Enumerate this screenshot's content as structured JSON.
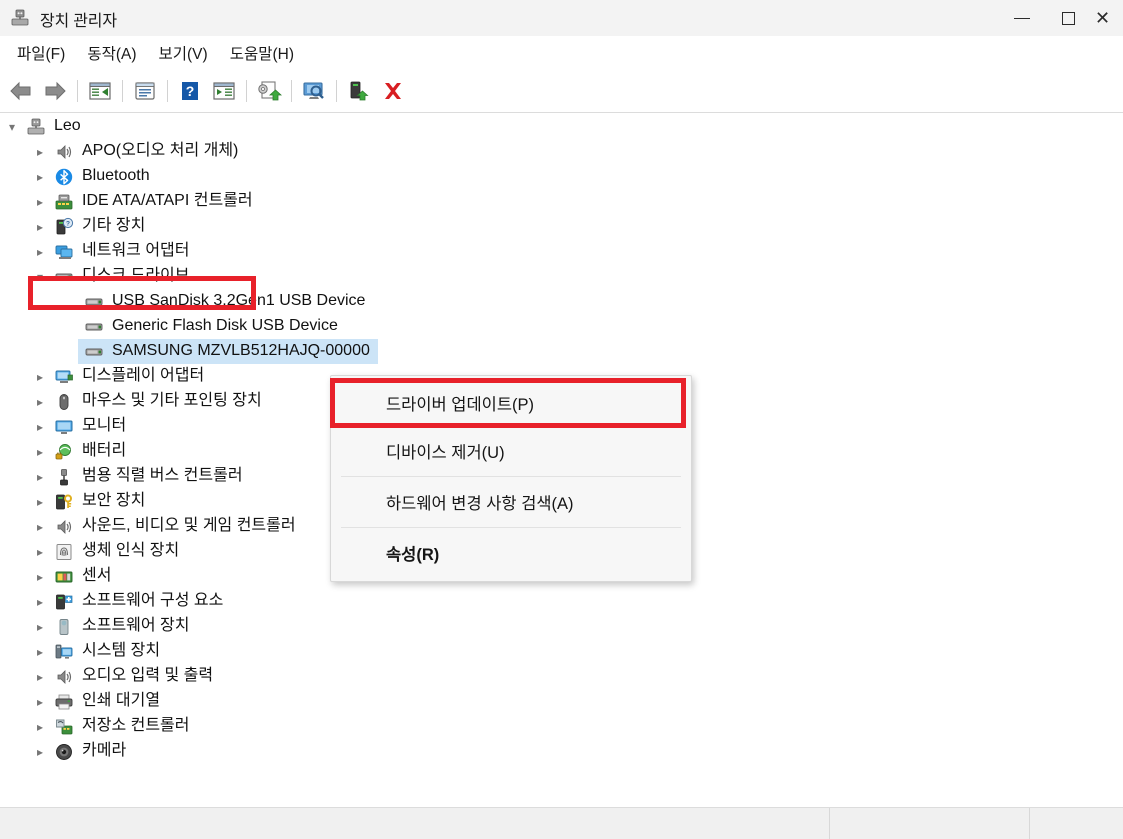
{
  "window": {
    "title": "장치 관리자",
    "icon": "device-manager-icon",
    "controls": {
      "minimize": "—",
      "maximize": "□",
      "close": "✕"
    }
  },
  "menubar": {
    "items": [
      {
        "label": "파일(F)",
        "name": "menu-file"
      },
      {
        "label": "동작(A)",
        "name": "menu-action"
      },
      {
        "label": "보기(V)",
        "name": "menu-view"
      },
      {
        "label": "도움말(H)",
        "name": "menu-help"
      }
    ]
  },
  "toolbar": {
    "buttons": [
      {
        "name": "back-arrow-icon",
        "tooltip": "뒤로"
      },
      {
        "name": "forward-arrow-icon",
        "tooltip": "앞으로"
      },
      {
        "name": "show-hide-console-tree-icon",
        "tooltip": "콘솔 트리 표시/숨기기"
      },
      {
        "name": "properties-icon",
        "tooltip": "속성"
      },
      {
        "name": "help-icon",
        "tooltip": "도움말"
      },
      {
        "name": "show-hide-action-pane-icon",
        "tooltip": "작업 창 표시/숨기기"
      },
      {
        "name": "update-driver-icon",
        "tooltip": "드라이버 업데이트"
      },
      {
        "name": "scan-hardware-changes-icon",
        "tooltip": "하드웨어 변경 사항 검색"
      },
      {
        "name": "enable-device-icon",
        "tooltip": "장치 사용"
      },
      {
        "name": "uninstall-device-icon",
        "tooltip": "디바이스 제거"
      }
    ]
  },
  "tree": {
    "root": {
      "label": "Leo",
      "icon": "computer-icon",
      "expanded": true
    },
    "items": [
      {
        "label": "APO(오디오 처리 개체)",
        "icon": "speaker-icon",
        "depth": 1,
        "expanded": false
      },
      {
        "label": "Bluetooth",
        "icon": "bluetooth-icon",
        "depth": 1,
        "expanded": false
      },
      {
        "label": "IDE ATA/ATAPI 컨트롤러",
        "icon": "ide-controller-icon",
        "depth": 1,
        "expanded": false
      },
      {
        "label": "기타 장치",
        "icon": "other-device-icon",
        "depth": 1,
        "expanded": false
      },
      {
        "label": "네트워크 어댑터",
        "icon": "network-adapter-icon",
        "depth": 1,
        "expanded": false
      },
      {
        "label": "디스크 드라이브",
        "icon": "disk-drive-icon",
        "depth": 1,
        "expanded": true,
        "highlighted": true
      },
      {
        "label": "USB  SanDisk 3.2Gen1 USB Device",
        "icon": "disk-drive-icon",
        "depth": 2
      },
      {
        "label": "Generic Flash Disk USB Device",
        "icon": "disk-drive-icon",
        "depth": 2
      },
      {
        "label": "SAMSUNG MZVLB512HAJQ-00000",
        "icon": "disk-drive-icon",
        "depth": 2,
        "selected": true
      },
      {
        "label": "디스플레이 어댑터",
        "icon": "display-adapter-icon",
        "depth": 1,
        "expanded": false
      },
      {
        "label": "마우스 및 기타 포인팅 장치",
        "icon": "mouse-icon",
        "depth": 1,
        "expanded": false
      },
      {
        "label": "모니터",
        "icon": "monitor-icon",
        "depth": 1,
        "expanded": false
      },
      {
        "label": "배터리",
        "icon": "battery-icon",
        "depth": 1,
        "expanded": false
      },
      {
        "label": "범용 직렬 버스 컨트롤러",
        "icon": "usb-controller-icon",
        "depth": 1,
        "expanded": false
      },
      {
        "label": "보안 장치",
        "icon": "security-device-icon",
        "depth": 1,
        "expanded": false
      },
      {
        "label": "사운드, 비디오 및 게임 컨트롤러",
        "icon": "speaker-icon",
        "depth": 1,
        "expanded": false
      },
      {
        "label": "생체 인식 장치",
        "icon": "fingerprint-icon",
        "depth": 1,
        "expanded": false
      },
      {
        "label": "센서",
        "icon": "sensor-icon",
        "depth": 1,
        "expanded": false
      },
      {
        "label": "소프트웨어 구성 요소",
        "icon": "software-component-icon",
        "depth": 1,
        "expanded": false
      },
      {
        "label": "소프트웨어 장치",
        "icon": "software-device-icon",
        "depth": 1,
        "expanded": false
      },
      {
        "label": "시스템 장치",
        "icon": "system-device-icon",
        "depth": 1,
        "expanded": false
      },
      {
        "label": "오디오 입력 및 출력",
        "icon": "speaker-icon",
        "depth": 1,
        "expanded": false
      },
      {
        "label": "인쇄 대기열",
        "icon": "printer-icon",
        "depth": 1,
        "expanded": false
      },
      {
        "label": "저장소 컨트롤러",
        "icon": "storage-controller-icon",
        "depth": 1,
        "expanded": false
      },
      {
        "label": "카메라",
        "icon": "camera-icon",
        "depth": 1,
        "expanded": false
      }
    ]
  },
  "context_menu": {
    "items": [
      {
        "label": "드라이버 업데이트(P)",
        "name": "ctx-update-driver",
        "bold": false,
        "highlighted": true
      },
      {
        "label": "디바이스 제거(U)",
        "name": "ctx-uninstall-device",
        "bold": false
      },
      {
        "separator_after": true
      },
      {
        "label": "하드웨어 변경 사항 검색(A)",
        "name": "ctx-scan-hardware-changes",
        "bold": false
      },
      {
        "separator_after": true
      },
      {
        "label": "속성(R)",
        "name": "ctx-properties",
        "bold": true
      }
    ]
  },
  "annotations": {
    "color": "#e8212a",
    "boxes": [
      {
        "name": "highlight-disk-drives",
        "target": "디스크 드라이브"
      },
      {
        "name": "highlight-update-driver",
        "target": "드라이버 업데이트(P)"
      }
    ]
  },
  "statusbar": {
    "segments": [
      "",
      "",
      ""
    ]
  }
}
